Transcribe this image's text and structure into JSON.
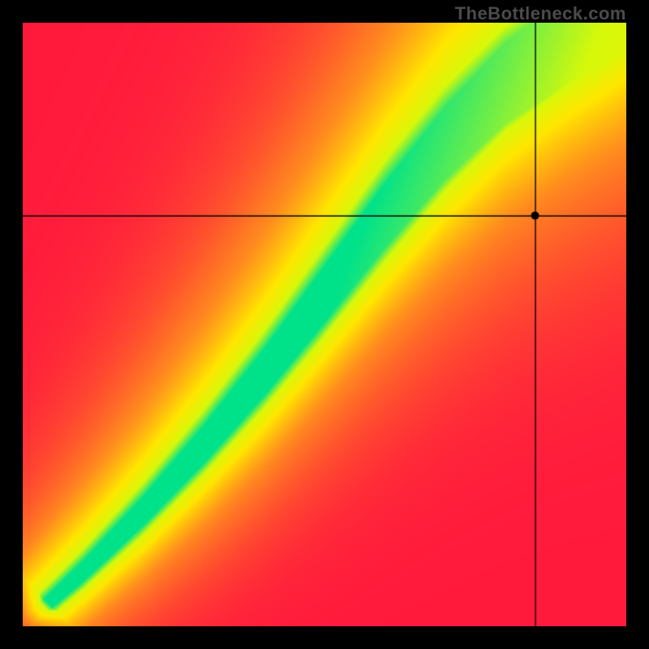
{
  "attribution": "TheBottleneck.com",
  "chart_data": {
    "type": "heatmap",
    "title": "",
    "xlabel": "",
    "ylabel": "",
    "xlim": [
      0,
      100
    ],
    "ylim": [
      0,
      100
    ],
    "axes_visible": false,
    "grid": false,
    "legend": false,
    "colorscale": {
      "description": "Red (mismatch) through Orange/Yellow to Green (optimal match)",
      "stops": [
        {
          "value": 0.0,
          "color": "#ff1a3c"
        },
        {
          "value": 0.45,
          "color": "#ff8a1f"
        },
        {
          "value": 0.72,
          "color": "#ffe600"
        },
        {
          "value": 0.88,
          "color": "#d7f80a"
        },
        {
          "value": 1.0,
          "color": "#00e28a"
        }
      ]
    },
    "optimal_curve": {
      "description": "Ridge of best match (green band center), y vs x (both 0-100)",
      "points": [
        {
          "x": 0,
          "y": 0
        },
        {
          "x": 10,
          "y": 9
        },
        {
          "x": 20,
          "y": 19
        },
        {
          "x": 30,
          "y": 30
        },
        {
          "x": 40,
          "y": 42
        },
        {
          "x": 50,
          "y": 55
        },
        {
          "x": 60,
          "y": 68
        },
        {
          "x": 70,
          "y": 80
        },
        {
          "x": 80,
          "y": 90
        },
        {
          "x": 90,
          "y": 97
        },
        {
          "x": 100,
          "y": 103
        }
      ],
      "band_halfwidth_start": 1,
      "band_halfwidth_end": 8
    },
    "crosshair_marker": {
      "x": 85,
      "y": 68,
      "dot_radius": 5,
      "color": "#000000"
    },
    "annotations": []
  }
}
